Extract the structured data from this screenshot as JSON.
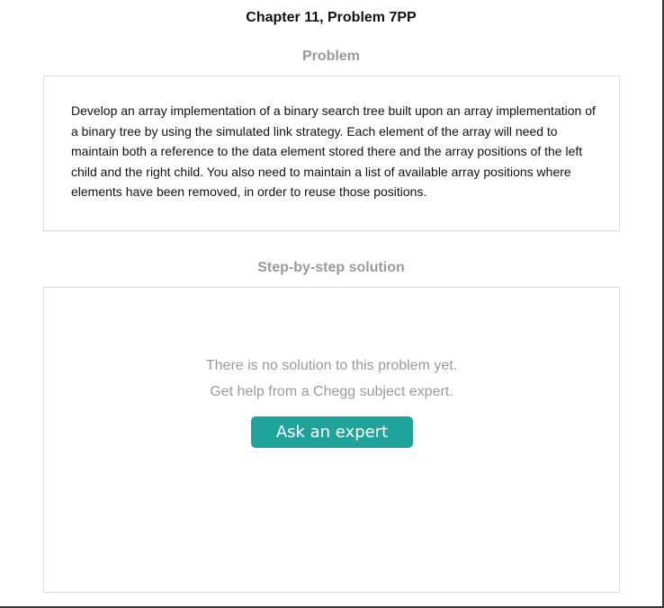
{
  "header": {
    "title": "Chapter 11, Problem 7PP"
  },
  "problem": {
    "heading": "Problem",
    "text": "Develop an array implementation of a binary search tree built upon an array implementation of a binary tree by using the simulated link strategy. Each element of the array will need to maintain both a reference to the data element stored there and the array positions of the left child and the right child. You also need to maintain a list of available array positions where elements have been removed, in order to reuse those positions."
  },
  "solution": {
    "heading": "Step-by-step solution",
    "empty_message_1": "There is no solution to this problem yet.",
    "empty_message_2": "Get help from a Chegg subject expert.",
    "ask_button_label": "Ask an expert"
  },
  "colors": {
    "accent": "#20a39a",
    "muted_text": "#9a9a9a",
    "border": "#dcdcdc"
  }
}
